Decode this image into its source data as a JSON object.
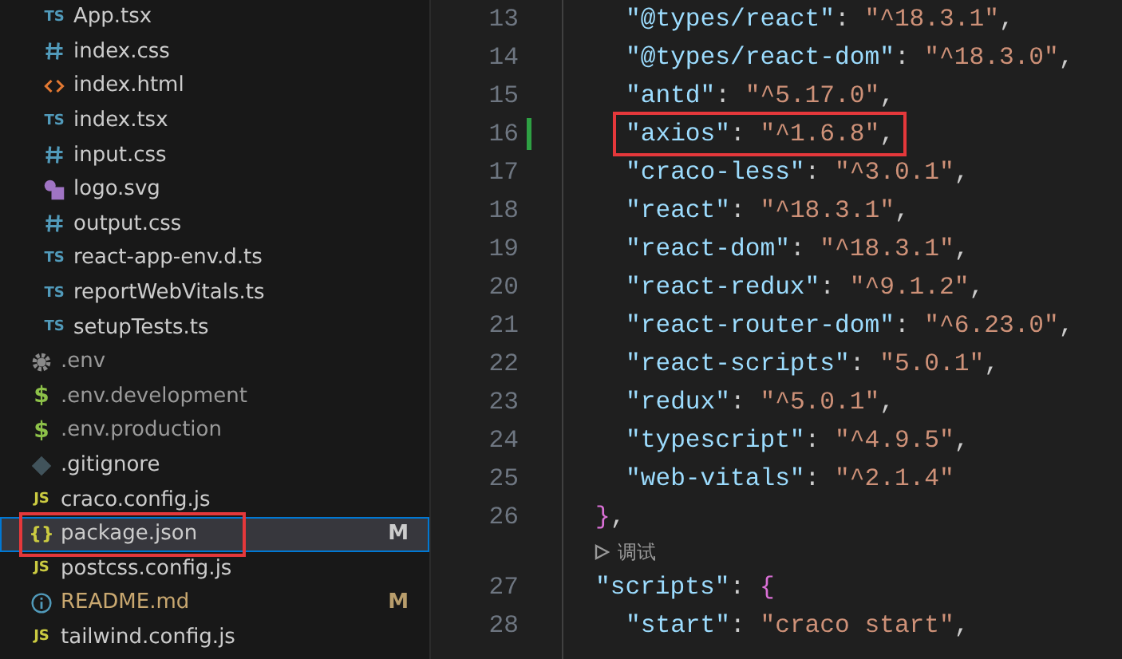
{
  "explorer": {
    "children": [
      {
        "name": "App.tsx",
        "kind": "ts",
        "icon_label": "TS",
        "selected": false,
        "highlighted": false
      },
      {
        "name": "index.css",
        "kind": "css",
        "selected": false,
        "highlighted": false
      },
      {
        "name": "index.html",
        "kind": "html",
        "selected": false,
        "highlighted": false
      },
      {
        "name": "index.tsx",
        "kind": "ts",
        "icon_label": "TS",
        "selected": false,
        "highlighted": false
      },
      {
        "name": "input.css",
        "kind": "css",
        "selected": false,
        "highlighted": false
      },
      {
        "name": "logo.svg",
        "kind": "svg",
        "selected": false,
        "highlighted": false
      },
      {
        "name": "output.css",
        "kind": "css",
        "selected": false,
        "highlighted": false
      },
      {
        "name": "react-app-env.d.ts",
        "kind": "ts",
        "icon_label": "TS",
        "selected": false,
        "highlighted": false
      },
      {
        "name": "reportWebVitals.ts",
        "kind": "ts",
        "icon_label": "TS",
        "selected": false,
        "highlighted": false
      },
      {
        "name": "setupTests.ts",
        "kind": "ts",
        "icon_label": "TS",
        "selected": false,
        "highlighted": false
      }
    ],
    "items": [
      {
        "name": ".env",
        "kind": "gear",
        "selected": false,
        "ignored": true,
        "highlighted": false
      },
      {
        "name": ".env.development",
        "kind": "dollar",
        "icon_label": "$",
        "selected": false,
        "ignored": true,
        "highlighted": false
      },
      {
        "name": ".env.production",
        "kind": "dollar",
        "icon_label": "$",
        "selected": false,
        "ignored": true,
        "highlighted": false
      },
      {
        "name": ".gitignore",
        "kind": "git",
        "selected": false,
        "ignored": false,
        "highlighted": false
      },
      {
        "name": "craco.config.js",
        "kind": "js",
        "icon_label": "JS",
        "selected": false,
        "ignored": false,
        "highlighted": false
      },
      {
        "name": "package.json",
        "kind": "json",
        "icon_label": "{}",
        "selected": true,
        "ignored": false,
        "status": "M",
        "highlighted": true
      },
      {
        "name": "postcss.config.js",
        "kind": "js",
        "icon_label": "JS",
        "selected": false,
        "ignored": false,
        "highlighted": false
      },
      {
        "name": "README.md",
        "kind": "info",
        "selected": false,
        "ignored": false,
        "status": "M",
        "highlighted": false
      },
      {
        "name": "tailwind.config.js",
        "kind": "js",
        "icon_label": "JS",
        "selected": false,
        "ignored": false,
        "highlighted": false
      }
    ]
  },
  "editor": {
    "lines": [
      {
        "number": "13",
        "kind": "inner",
        "modified": false,
        "highlighted": false,
        "parts": [
          {
            "kind": "key",
            "text": "\"@types/react\""
          },
          {
            "kind": "punct",
            "text": ": "
          },
          {
            "kind": "string",
            "text": "\"^18.3.1\""
          },
          {
            "kind": "punct",
            "text": ","
          }
        ]
      },
      {
        "number": "14",
        "kind": "inner",
        "modified": false,
        "highlighted": false,
        "parts": [
          {
            "kind": "key",
            "text": "\"@types/react-dom\""
          },
          {
            "kind": "punct",
            "text": ": "
          },
          {
            "kind": "string",
            "text": "\"^18.3.0\""
          },
          {
            "kind": "punct",
            "text": ","
          }
        ]
      },
      {
        "number": "15",
        "kind": "inner",
        "modified": false,
        "highlighted": false,
        "parts": [
          {
            "kind": "key",
            "text": "\"antd\""
          },
          {
            "kind": "punct",
            "text": ": "
          },
          {
            "kind": "string",
            "text": "\"^5.17.0\""
          },
          {
            "kind": "punct",
            "text": ","
          }
        ]
      },
      {
        "number": "16",
        "kind": "inner",
        "modified": true,
        "highlighted": true,
        "parts": [
          {
            "kind": "key",
            "text": "\"axios\""
          },
          {
            "kind": "punct",
            "text": ": "
          },
          {
            "kind": "string",
            "text": "\"^1.6.8\""
          },
          {
            "kind": "punct",
            "text": ","
          }
        ]
      },
      {
        "number": "17",
        "kind": "inner",
        "modified": false,
        "highlighted": false,
        "parts": [
          {
            "kind": "key",
            "text": "\"craco-less\""
          },
          {
            "kind": "punct",
            "text": ": "
          },
          {
            "kind": "string",
            "text": "\"^3.0.1\""
          },
          {
            "kind": "punct",
            "text": ","
          }
        ]
      },
      {
        "number": "18",
        "kind": "inner",
        "modified": false,
        "highlighted": false,
        "parts": [
          {
            "kind": "key",
            "text": "\"react\""
          },
          {
            "kind": "punct",
            "text": ": "
          },
          {
            "kind": "string",
            "text": "\"^18.3.1\""
          },
          {
            "kind": "punct",
            "text": ","
          }
        ]
      },
      {
        "number": "19",
        "kind": "inner",
        "modified": false,
        "highlighted": false,
        "parts": [
          {
            "kind": "key",
            "text": "\"react-dom\""
          },
          {
            "kind": "punct",
            "text": ": "
          },
          {
            "kind": "string",
            "text": "\"^18.3.1\""
          },
          {
            "kind": "punct",
            "text": ","
          }
        ]
      },
      {
        "number": "20",
        "kind": "inner",
        "modified": false,
        "highlighted": false,
        "parts": [
          {
            "kind": "key",
            "text": "\"react-redux\""
          },
          {
            "kind": "punct",
            "text": ": "
          },
          {
            "kind": "string",
            "text": "\"^9.1.2\""
          },
          {
            "kind": "punct",
            "text": ","
          }
        ]
      },
      {
        "number": "21",
        "kind": "inner",
        "modified": false,
        "highlighted": false,
        "parts": [
          {
            "kind": "key",
            "text": "\"react-router-dom\""
          },
          {
            "kind": "punct",
            "text": ": "
          },
          {
            "kind": "string",
            "text": "\"^6.23.0\""
          },
          {
            "kind": "punct",
            "text": ","
          }
        ]
      },
      {
        "number": "22",
        "kind": "inner",
        "modified": false,
        "highlighted": false,
        "parts": [
          {
            "kind": "key",
            "text": "\"react-scripts\""
          },
          {
            "kind": "punct",
            "text": ": "
          },
          {
            "kind": "string",
            "text": "\"5.0.1\""
          },
          {
            "kind": "punct",
            "text": ","
          }
        ]
      },
      {
        "number": "23",
        "kind": "inner",
        "modified": false,
        "highlighted": false,
        "parts": [
          {
            "kind": "key",
            "text": "\"redux\""
          },
          {
            "kind": "punct",
            "text": ": "
          },
          {
            "kind": "string",
            "text": "\"^5.0.1\""
          },
          {
            "kind": "punct",
            "text": ","
          }
        ]
      },
      {
        "number": "24",
        "kind": "inner",
        "modified": false,
        "highlighted": false,
        "parts": [
          {
            "kind": "key",
            "text": "\"typescript\""
          },
          {
            "kind": "punct",
            "text": ": "
          },
          {
            "kind": "string",
            "text": "\"^4.9.5\""
          },
          {
            "kind": "punct",
            "text": ","
          }
        ]
      },
      {
        "number": "25",
        "kind": "inner",
        "modified": false,
        "highlighted": false,
        "parts": [
          {
            "kind": "key",
            "text": "\"web-vitals\""
          },
          {
            "kind": "punct",
            "text": ": "
          },
          {
            "kind": "string",
            "text": "\"^2.1.4\""
          }
        ]
      },
      {
        "number": "26",
        "kind": "outer",
        "modified": false,
        "highlighted": false,
        "parts": [
          {
            "kind": "bracket",
            "text": "}"
          },
          {
            "kind": "punct",
            "text": ","
          }
        ]
      },
      {
        "kind": "codelens",
        "text": "调试"
      },
      {
        "number": "27",
        "kind": "outer",
        "modified": false,
        "highlighted": false,
        "parts": [
          {
            "kind": "key",
            "text": "\"scripts\""
          },
          {
            "kind": "punct",
            "text": ": "
          },
          {
            "kind": "bracket",
            "text": "{"
          }
        ]
      },
      {
        "number": "28",
        "kind": "inner",
        "modified": false,
        "highlighted": false,
        "parts": [
          {
            "kind": "key",
            "text": "\"start\""
          },
          {
            "kind": "punct",
            "text": ": "
          },
          {
            "kind": "string",
            "text": "\"craco start\""
          },
          {
            "kind": "punct",
            "text": ","
          }
        ]
      }
    ]
  }
}
